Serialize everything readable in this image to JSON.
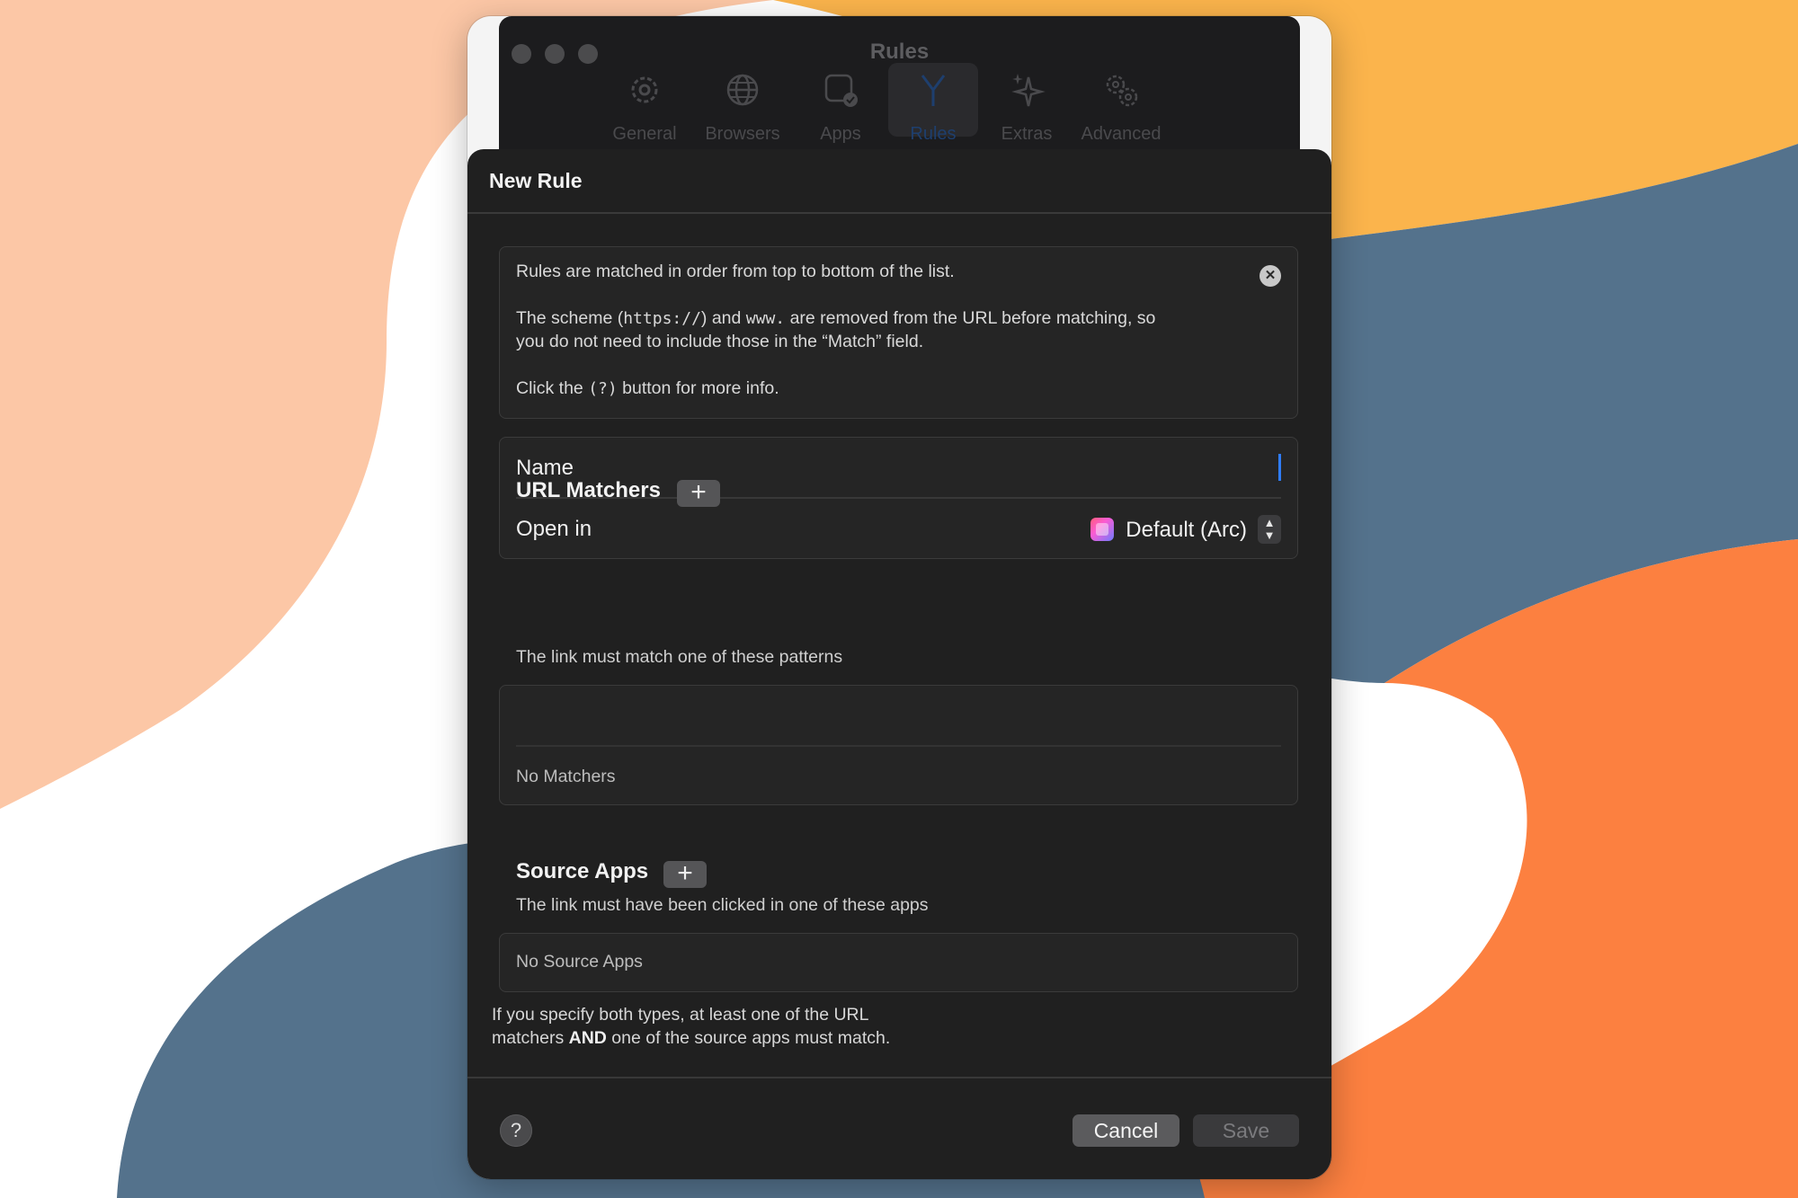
{
  "window": {
    "title": "Rules",
    "toolbar": [
      {
        "label": "General",
        "icon": "gear-icon"
      },
      {
        "label": "Browsers",
        "icon": "globe-icon"
      },
      {
        "label": "Apps",
        "icon": "app-check-icon"
      },
      {
        "label": "Rules",
        "icon": "fork-icon",
        "selected": true
      },
      {
        "label": "Extras",
        "icon": "sparkles-icon"
      },
      {
        "label": "Advanced",
        "icon": "gears-icon"
      }
    ]
  },
  "sheet": {
    "title": "New Rule",
    "info": {
      "line1": "Rules are matched in order from top to bottom of the list.",
      "line2_pre": "The scheme (",
      "line2_code1": "https://",
      "line2_mid": ") and ",
      "line2_code2": "www.",
      "line2_post": " are removed from the URL before matching, so",
      "line3": "you do not need to include those in the “Match” field.",
      "line4_pre": "Click the ",
      "line4_code": "(?)",
      "line4_post": " button for more info."
    },
    "form": {
      "name_label": "Name",
      "name_value": "",
      "open_in_label": "Open in",
      "open_in_value": "Default (Arc)"
    },
    "url_matchers": {
      "title": "URL Matchers",
      "subtitle": "The link must match one of these patterns",
      "empty": "No Matchers"
    },
    "source_apps": {
      "title": "Source Apps",
      "subtitle": "The link must have been clicked in one of these apps",
      "empty": "No Source Apps"
    },
    "footnote": {
      "line1": "If you specify both types, at least one of the URL",
      "line2_pre": "matchers ",
      "line2_bold": "AND",
      "line2_post": " one of the source apps must match."
    },
    "buttons": {
      "help": "?",
      "cancel": "Cancel",
      "save": "Save"
    }
  },
  "colors": {
    "accent": "#2f7cf6",
    "sheet_bg": "#202020",
    "bg_peach": "#fcc7a6",
    "bg_yellow": "#fbb44c",
    "bg_slate": "#54728c",
    "bg_orange": "#fc8040"
  }
}
